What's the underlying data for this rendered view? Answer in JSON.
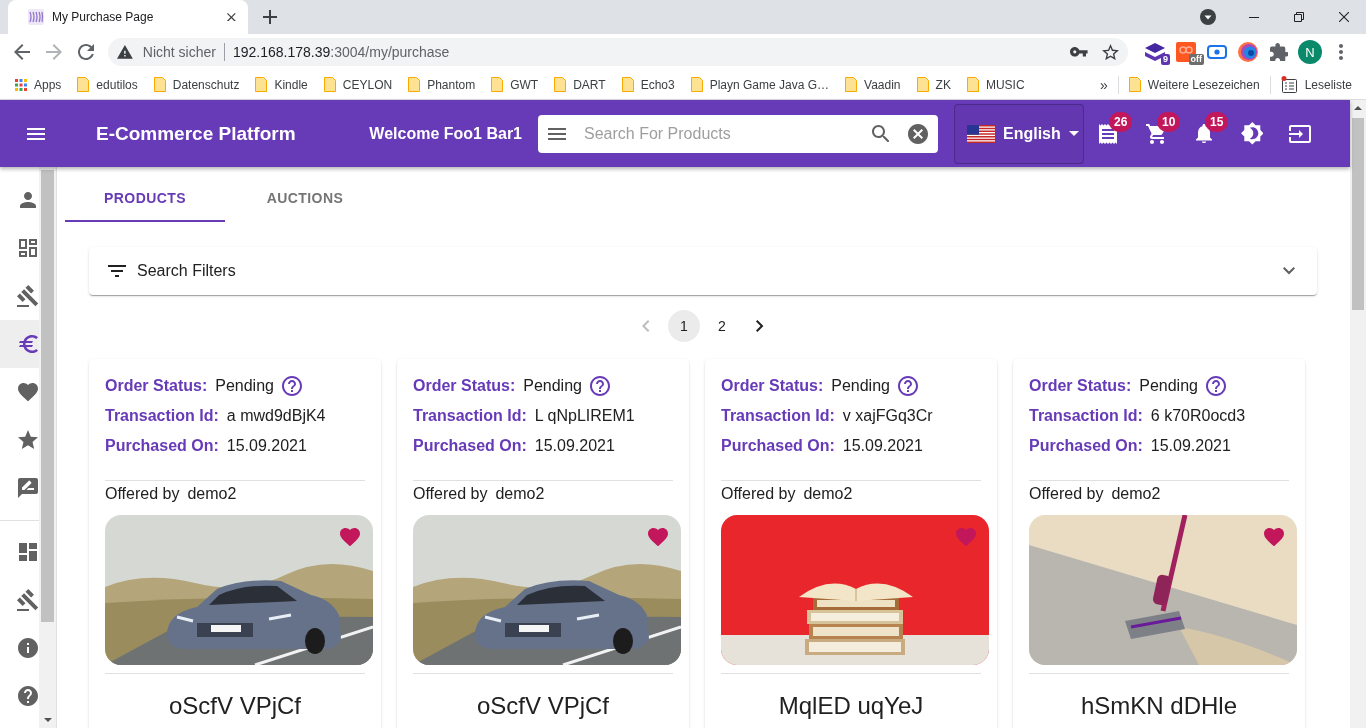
{
  "browser": {
    "tabs": [
      {
        "title": "My Purchase Page",
        "selected": true
      }
    ],
    "address_bar": {
      "security": "Nicht sicher",
      "host": "192.168.178.39",
      "path": ":3004/my/purchase"
    },
    "extensions": [
      {
        "kind": "layers",
        "badge": "9"
      },
      {
        "kind": "tile",
        "badge": "off"
      },
      {
        "kind": "record"
      },
      {
        "kind": "globe"
      },
      {
        "kind": "puzzle"
      }
    ],
    "profile": {
      "initial": "N"
    },
    "bookmarks": [
      {
        "kind": "apps",
        "label": "Apps"
      },
      {
        "kind": "folder",
        "label": "edutilos"
      },
      {
        "kind": "folder",
        "label": "Datenschutz"
      },
      {
        "kind": "folder",
        "label": "Kindle"
      },
      {
        "kind": "folder",
        "label": "CEYLON"
      },
      {
        "kind": "folder",
        "label": "Phantom"
      },
      {
        "kind": "folder",
        "label": "GWT"
      },
      {
        "kind": "folder",
        "label": "DART"
      },
      {
        "kind": "folder",
        "label": "Echo3"
      },
      {
        "kind": "folder",
        "label": "Playn Game Java G…"
      },
      {
        "kind": "folder",
        "label": "Vaadin"
      },
      {
        "kind": "folder",
        "label": "ZK"
      },
      {
        "kind": "folder",
        "label": "MUSIC"
      }
    ],
    "more_bookmarks": "»",
    "other_bookmarks": {
      "label": "Weitere Lesezeichen"
    },
    "reading_list": {
      "label": "Leseliste",
      "unread": true
    }
  },
  "header": {
    "title": "E-Commerce Platform",
    "welcome": "Welcome Foo1 Bar1",
    "search": {
      "placeholder": "Search For Products"
    },
    "language": {
      "label": "English"
    },
    "actions": [
      {
        "kind": "receipt",
        "badge": "26"
      },
      {
        "kind": "cart",
        "badge": "10"
      },
      {
        "kind": "bell",
        "badge": "15"
      },
      {
        "kind": "brightness"
      },
      {
        "kind": "login"
      }
    ]
  },
  "sidebar": {
    "sections": [
      {
        "items": [
          {
            "kind": "person",
            "selected": false
          },
          {
            "kind": "dashboard-outline",
            "selected": false
          },
          {
            "kind": "gavel",
            "selected": false
          },
          {
            "kind": "euro",
            "selected": true
          },
          {
            "kind": "heart",
            "selected": false
          },
          {
            "kind": "star",
            "selected": false
          },
          {
            "kind": "review",
            "selected": false
          }
        ]
      },
      {
        "items": [
          {
            "kind": "dashboard",
            "selected": false
          },
          {
            "kind": "gavel",
            "selected": false
          },
          {
            "kind": "info",
            "selected": false
          },
          {
            "kind": "help",
            "selected": false
          }
        ]
      }
    ]
  },
  "tabs": [
    {
      "label": "PRODUCTS",
      "selected": true
    },
    {
      "label": "AUCTIONS",
      "selected": false
    }
  ],
  "filters": {
    "label": "Search Filters",
    "expanded": false
  },
  "pagination": {
    "previous": {
      "disabled": true
    },
    "pages": [
      {
        "label": "1",
        "selected": true
      },
      {
        "label": "2",
        "selected": false
      }
    ],
    "next": {
      "disabled": false
    }
  },
  "orders": [
    {
      "fields": [
        {
          "kind": "status",
          "label": "Order Status:",
          "value": "Pending"
        },
        {
          "kind": "text",
          "label": "Transaction Id:",
          "value": "a mwd9dBjK4"
        },
        {
          "kind": "text",
          "label": "Purchased On:",
          "value": "15.09.2021"
        }
      ],
      "offered_by_label": "Offered by",
      "seller": "demo2",
      "photo": {
        "kind": "car"
      },
      "favorite": true,
      "title": "oScfV VPjCf"
    },
    {
      "fields": [
        {
          "kind": "status",
          "label": "Order Status:",
          "value": "Pending"
        },
        {
          "kind": "text",
          "label": "Transaction Id:",
          "value": "L qNpLIREM1"
        },
        {
          "kind": "text",
          "label": "Purchased On:",
          "value": "15.09.2021"
        }
      ],
      "offered_by_label": "Offered by",
      "seller": "demo2",
      "photo": {
        "kind": "car"
      },
      "favorite": true,
      "title": "oScfV VPjCf"
    },
    {
      "fields": [
        {
          "kind": "status",
          "label": "Order Status:",
          "value": "Pending"
        },
        {
          "kind": "text",
          "label": "Transaction Id:",
          "value": "v xajFGq3Cr"
        },
        {
          "kind": "text",
          "label": "Purchased On:",
          "value": "15.09.2021"
        }
      ],
      "offered_by_label": "Offered by",
      "seller": "demo2",
      "photo": {
        "kind": "books"
      },
      "favorite": true,
      "title": "MqlED uqYeJ"
    },
    {
      "fields": [
        {
          "kind": "status",
          "label": "Order Status:",
          "value": "Pending"
        },
        {
          "kind": "text",
          "label": "Transaction Id:",
          "value": "6 k70R0ocd3"
        },
        {
          "kind": "text",
          "label": "Purchased On:",
          "value": "15.09.2021"
        }
      ],
      "offered_by_label": "Offered by",
      "seller": "demo2",
      "photo": {
        "kind": "vacuum"
      },
      "favorite": true,
      "title": "hSmKN dDHle"
    }
  ]
}
